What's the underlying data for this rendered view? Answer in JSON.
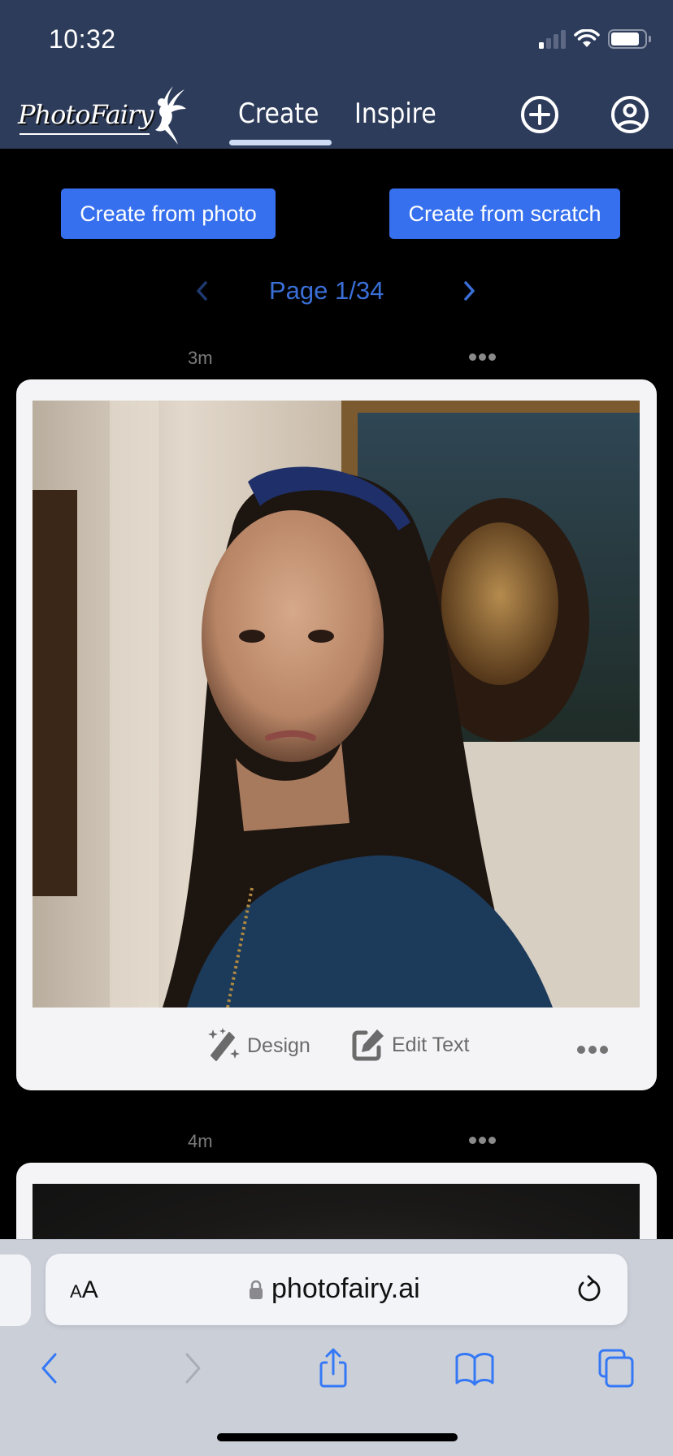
{
  "status_bar": {
    "time": "10:32",
    "signal_bars_on": 1,
    "signal_bars_total": 4,
    "battery_level": 0.8
  },
  "header": {
    "logo_text": "PhotoFairy",
    "tabs": [
      {
        "label": "Create",
        "active": true
      },
      {
        "label": "Inspire",
        "active": false
      }
    ],
    "icons": [
      "plus-circle-icon",
      "user-circle-icon"
    ]
  },
  "actions": {
    "create_from_photo": "Create from photo",
    "create_from_scratch": "Create from scratch"
  },
  "pager": {
    "label": "Page 1/34",
    "current": 1,
    "total": 34
  },
  "posts": [
    {
      "time": "3m",
      "image_description": "AI portrait of a woman with long dark hair and blue headband in a museum beside the Mona Lisa",
      "actions": [
        {
          "label": "Design",
          "icon": "magic-wand-icon"
        },
        {
          "label": "Edit Text",
          "icon": "edit-square-icon"
        }
      ]
    },
    {
      "time": "4m",
      "image_description": "dark vignette photo (partially visible)"
    }
  ],
  "browser": {
    "text_size_label_small": "A",
    "text_size_label_large": "A",
    "url": "photofairy.ai",
    "toolbar": [
      "back",
      "forward",
      "share",
      "bookmarks",
      "tabs"
    ]
  },
  "colors": {
    "header_bg": "#2e3c5b",
    "accent": "#3670ee",
    "pager_text": "#3a6fd8",
    "card_bg": "#f4f3f5",
    "safari_blue": "#3478f6"
  }
}
